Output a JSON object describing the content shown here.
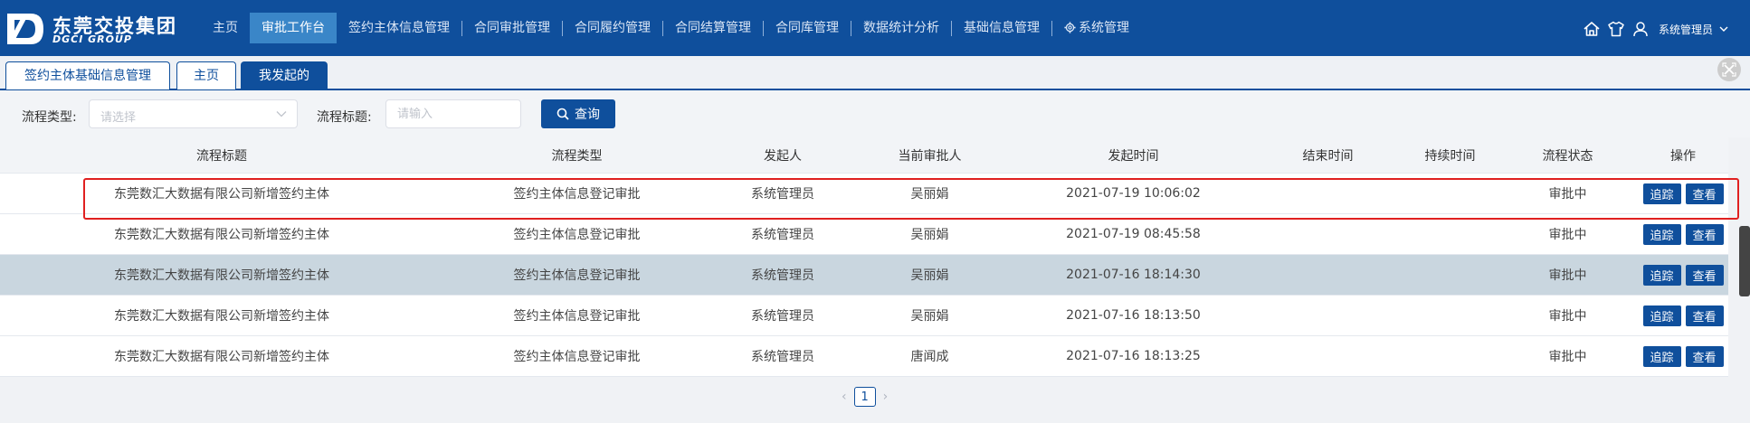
{
  "app": {
    "logo_cn": "东莞交投集团",
    "logo_en": "DGCI GROUP",
    "brand_color": "#0f4f9c",
    "accent_color": "#3a86c8"
  },
  "nav": {
    "items": [
      {
        "label": "主页"
      },
      {
        "label": "审批工作台"
      },
      {
        "label": "签约主体信息管理"
      },
      {
        "label": "合同审批管理"
      },
      {
        "label": "合同履约管理"
      },
      {
        "label": "合同结算管理"
      },
      {
        "label": "合同库管理"
      },
      {
        "label": "数据统计分析"
      },
      {
        "label": "基础信息管理"
      },
      {
        "label": "系统管理",
        "icon": "gear-icon"
      }
    ],
    "active_index": 1,
    "user_label": "系统管理员",
    "icons": [
      "home-icon",
      "shirt-icon",
      "user-icon",
      "chevron-down-icon"
    ]
  },
  "tabs": [
    {
      "label": "签约主体基础信息管理"
    },
    {
      "label": "主页"
    },
    {
      "label": "我发起的"
    }
  ],
  "filter": {
    "type_label": "流程类型:",
    "type_placeholder": "请选择",
    "title_label": "流程标题:",
    "title_placeholder": "请输入",
    "query_label": "查询"
  },
  "table": {
    "columns": [
      "流程标题",
      "流程类型",
      "发起人",
      "当前审批人",
      "发起时间",
      "结束时间",
      "持续时间",
      "流程状态",
      "操作"
    ],
    "rows": [
      {
        "title": "东莞数汇大数据有限公司新增签约主体",
        "type": "签约主体信息登记审批",
        "initiator": "系统管理员",
        "approver": "吴丽娟",
        "start": "2021-07-19 10:06:02",
        "end": "",
        "duration": "",
        "status": "审批中",
        "track": "追踪",
        "view": "查看"
      },
      {
        "title": "东莞数汇大数据有限公司新增签约主体",
        "type": "签约主体信息登记审批",
        "initiator": "系统管理员",
        "approver": "吴丽娟",
        "start": "2021-07-19 08:45:58",
        "end": "",
        "duration": "",
        "status": "审批中",
        "track": "追踪",
        "view": "查看"
      },
      {
        "title": "东莞数汇大数据有限公司新增签约主体",
        "type": "签约主体信息登记审批",
        "initiator": "系统管理员",
        "approver": "吴丽娟",
        "start": "2021-07-16 18:14:30",
        "end": "",
        "duration": "",
        "status": "审批中",
        "track": "追踪",
        "view": "查看"
      },
      {
        "title": "东莞数汇大数据有限公司新增签约主体",
        "type": "签约主体信息登记审批",
        "initiator": "系统管理员",
        "approver": "吴丽娟",
        "start": "2021-07-16 18:13:50",
        "end": "",
        "duration": "",
        "status": "审批中",
        "track": "追踪",
        "view": "查看"
      },
      {
        "title": "东莞数汇大数据有限公司新增签约主体",
        "type": "签约主体信息登记审批",
        "initiator": "系统管理员",
        "approver": "唐闻成",
        "start": "2021-07-16 18:13:25",
        "end": "",
        "duration": "",
        "status": "审批中",
        "track": "追踪",
        "view": "查看"
      }
    ],
    "selected_row_index": 2,
    "highlighted_row_index": 0
  },
  "pagination": {
    "prev": "‹",
    "current": "1",
    "next": "›"
  }
}
